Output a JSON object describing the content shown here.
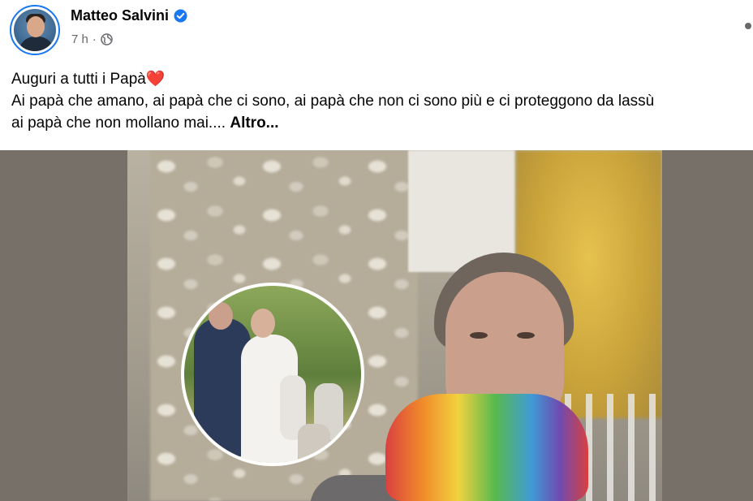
{
  "header": {
    "author_name": "Matteo Salvini",
    "verified": true,
    "time": "7 h",
    "separator": "·",
    "audience_icon": "globe-icon",
    "more_icon": "more-dots-icon"
  },
  "text": {
    "line1": "Auguri a tutti i Papà",
    "line1_emoji": "❤️",
    "line2": "Ai papà che amano, ai papà che ci sono, ai papà che non ci sono più e ci proteggono da lassù",
    "line3": "ai papà che non mollano mai.... ",
    "more_label": "Altro..."
  },
  "colors": {
    "verified_blue": "#1877f2",
    "meta_grey": "#65676b",
    "heart_red": "#e41e3f"
  }
}
